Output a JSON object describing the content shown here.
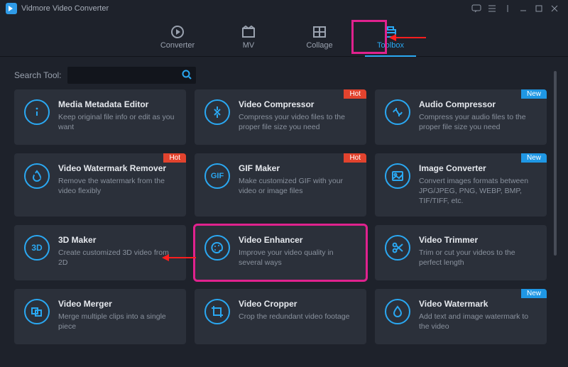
{
  "app": {
    "title": "Vidmore Video Converter"
  },
  "tabs": [
    {
      "id": "converter",
      "label": "Converter"
    },
    {
      "id": "mv",
      "label": "MV"
    },
    {
      "id": "collage",
      "label": "Collage"
    },
    {
      "id": "toolbox",
      "label": "Toolbox",
      "active": true
    }
  ],
  "search": {
    "label": "Search Tool:",
    "placeholder": ""
  },
  "badges": {
    "hot": "Hot",
    "new": "New"
  },
  "tools": [
    {
      "id": "media-metadata-editor",
      "title": "Media Metadata Editor",
      "desc": "Keep original file info or edit as you want",
      "badge": null,
      "icon": "info"
    },
    {
      "id": "video-compressor",
      "title": "Video Compressor",
      "desc": "Compress your video files to the proper file size you need",
      "badge": "hot",
      "icon": "compress-v"
    },
    {
      "id": "audio-compressor",
      "title": "Audio Compressor",
      "desc": "Compress your audio files to the proper file size you need",
      "badge": "new",
      "icon": "compress-a"
    },
    {
      "id": "video-watermark-remover",
      "title": "Video Watermark Remover",
      "desc": "Remove the watermark from the video flexibly",
      "badge": "hot",
      "icon": "droplet"
    },
    {
      "id": "gif-maker",
      "title": "GIF Maker",
      "desc": "Make customized GIF with your video or image files",
      "badge": "hot",
      "icon": "gif"
    },
    {
      "id": "image-converter",
      "title": "Image Converter",
      "desc": "Convert images formats between JPG/JPEG, PNG, WEBP, BMP, TIF/TIFF, etc.",
      "badge": "new",
      "icon": "image"
    },
    {
      "id": "3d-maker",
      "title": "3D Maker",
      "desc": "Create customized 3D video from 2D",
      "badge": null,
      "icon": "3d"
    },
    {
      "id": "video-enhancer",
      "title": "Video Enhancer",
      "desc": "Improve your video quality in several ways",
      "badge": null,
      "icon": "palette",
      "highlight": true
    },
    {
      "id": "video-trimmer",
      "title": "Video Trimmer",
      "desc": "Trim or cut your videos to the perfect length",
      "badge": null,
      "icon": "scissors"
    },
    {
      "id": "video-merger",
      "title": "Video Merger",
      "desc": "Merge multiple clips into a single piece",
      "badge": null,
      "icon": "merge"
    },
    {
      "id": "video-cropper",
      "title": "Video Cropper",
      "desc": "Crop the redundant video footage",
      "badge": null,
      "icon": "crop"
    },
    {
      "id": "video-watermark",
      "title": "Video Watermark",
      "desc": "Add text and image watermark to the video",
      "badge": "new",
      "icon": "water"
    }
  ]
}
